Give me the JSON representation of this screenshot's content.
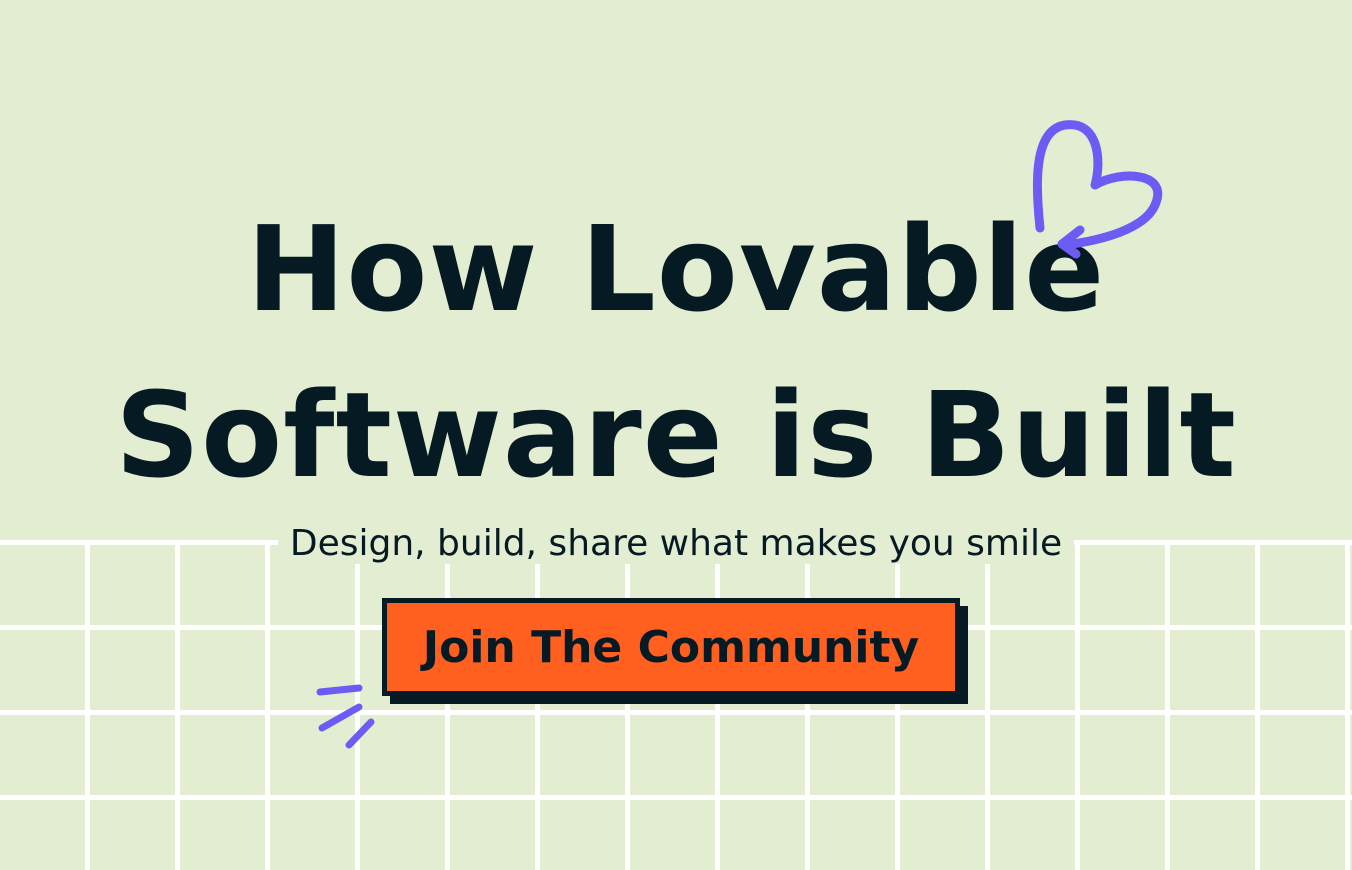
{
  "hero": {
    "headline_line1": "How Lovable",
    "headline_line2": "Software is Built",
    "subtitle": "Design, build, share what makes you smile",
    "cta_label": "Join The Community"
  },
  "icons": {
    "heart": "heart-arrow-doodle-icon",
    "sparkle": "sparkle-lines-doodle-icon"
  },
  "colors": {
    "background": "#e3edd2",
    "grid_lines": "#ffffff",
    "text": "#061a24",
    "cta_fill": "#ff5f1f",
    "doodle": "#6c5cf4"
  }
}
